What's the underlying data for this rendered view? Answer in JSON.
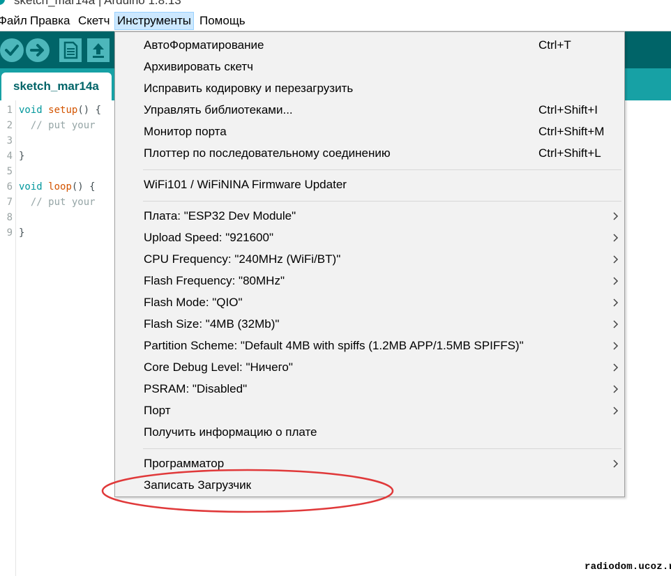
{
  "window": {
    "title": "sketch_mar14a | Arduino 1.8.13"
  },
  "menubar": {
    "items": [
      {
        "label": "Файл"
      },
      {
        "label": "Правка"
      },
      {
        "label": "Скетч"
      },
      {
        "label": "Инструменты"
      },
      {
        "label": "Помощь"
      }
    ]
  },
  "toolbar": {
    "buttons": [
      {
        "icon": "verify-icon"
      },
      {
        "icon": "upload-icon"
      },
      {
        "icon": "new-icon"
      },
      {
        "icon": "open-icon"
      }
    ]
  },
  "tabs": [
    {
      "label": "sketch_mar14a"
    }
  ],
  "editor": {
    "lines": [
      {
        "num": "1",
        "tokens": [
          [
            "kw",
            "void"
          ],
          [
            "",
            ""
          ],
          [
            "fn",
            "setup"
          ],
          [
            "",
            "() {"
          ]
        ]
      },
      {
        "num": "2",
        "tokens": [
          [
            "",
            "  "
          ],
          [
            "cm",
            "// put your"
          ]
        ]
      },
      {
        "num": "3",
        "tokens": []
      },
      {
        "num": "4",
        "tokens": [
          [
            "",
            "}"
          ]
        ]
      },
      {
        "num": "5",
        "tokens": []
      },
      {
        "num": "6",
        "tokens": [
          [
            "kw",
            "void"
          ],
          [
            "",
            ""
          ],
          [
            "fn",
            "loop"
          ],
          [
            "",
            "() {"
          ]
        ]
      },
      {
        "num": "7",
        "tokens": [
          [
            "",
            "  "
          ],
          [
            "cm",
            "// put your"
          ]
        ]
      },
      {
        "num": "8",
        "tokens": []
      },
      {
        "num": "9",
        "tokens": [
          [
            "",
            "}"
          ]
        ]
      }
    ]
  },
  "dropdown": {
    "groups": [
      [
        {
          "label": "АвтоФорматирование",
          "shortcut": "Ctrl+T"
        },
        {
          "label": "Архивировать скетч",
          "shortcut": ""
        },
        {
          "label": "Исправить кодировку и перезагрузить",
          "shortcut": ""
        },
        {
          "label": "Управлять библиотеками...",
          "shortcut": "Ctrl+Shift+I"
        },
        {
          "label": "Монитор порта",
          "shortcut": "Ctrl+Shift+M"
        },
        {
          "label": "Плоттер по последовательному соединению",
          "shortcut": "Ctrl+Shift+L"
        }
      ],
      [
        {
          "label": "WiFi101 / WiFiNINA Firmware Updater",
          "shortcut": ""
        }
      ],
      [
        {
          "label": "Плата: \"ESP32 Dev Module\"",
          "submenu": true
        },
        {
          "label": "Upload Speed: \"921600\"",
          "submenu": true
        },
        {
          "label": "CPU Frequency: \"240MHz (WiFi/BT)\"",
          "submenu": true
        },
        {
          "label": "Flash Frequency: \"80MHz\"",
          "submenu": true
        },
        {
          "label": "Flash Mode: \"QIO\"",
          "submenu": true
        },
        {
          "label": "Flash Size: \"4MB (32Mb)\"",
          "submenu": true
        },
        {
          "label": "Partition Scheme: \"Default 4MB with spiffs (1.2MB APP/1.5MB SPIFFS)\"",
          "submenu": true
        },
        {
          "label": "Core Debug Level: \"Ничего\"",
          "submenu": true
        },
        {
          "label": "PSRAM: \"Disabled\"",
          "submenu": true
        },
        {
          "label": "Порт",
          "submenu": true
        },
        {
          "label": "Получить информацию о плате",
          "submenu": false
        }
      ],
      [
        {
          "label": "Программатор",
          "submenu": true
        },
        {
          "label": "Записать Загрузчик",
          "submenu": false,
          "highlighted": true
        }
      ]
    ]
  },
  "annotation": {
    "color": "#e0393a"
  },
  "watermark": {
    "text": "radiodom.ucoz.ru"
  },
  "colors": {
    "toolbar": "#006468",
    "tabbar": "#17a1a5",
    "button": "#4db7bb",
    "menu_bg": "#f2f2f2"
  }
}
